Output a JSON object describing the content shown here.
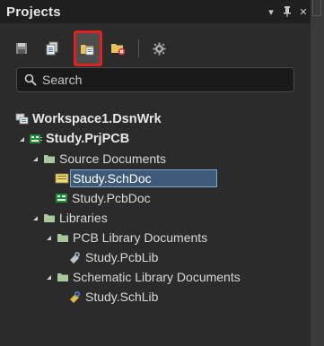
{
  "panel": {
    "title": "Projects"
  },
  "title_buttons": {
    "menu_glyph": "▾",
    "pin_glyph": "🖈",
    "close_glyph": "✕"
  },
  "toolbar": {
    "tools": [
      {
        "name": "save-icon"
      },
      {
        "name": "copy-documents-icon"
      },
      {
        "name": "project-folder-icon",
        "highlighted": true
      },
      {
        "name": "folder-close-icon"
      },
      {
        "name": "gear-icon"
      }
    ]
  },
  "search": {
    "placeholder": "Search"
  },
  "tree": {
    "workspace": "Workspace1.DsnWrk",
    "project": "Study.PrjPCB",
    "source_documents": "Source Documents",
    "schdoc": "Study.SchDoc",
    "pcbdoc": "Study.PcbDoc",
    "libraries": "Libraries",
    "pcb_library_documents": "PCB Library Documents",
    "pcblib": "Study.PcbLib",
    "schematic_library_documents": "Schematic Library Documents",
    "schlib": "Study.SchLib"
  },
  "colors": {
    "background": "#2b2b2b",
    "selection": "#3e5a78",
    "highlight_border": "#e0211d",
    "folder": "#a9c89a"
  }
}
